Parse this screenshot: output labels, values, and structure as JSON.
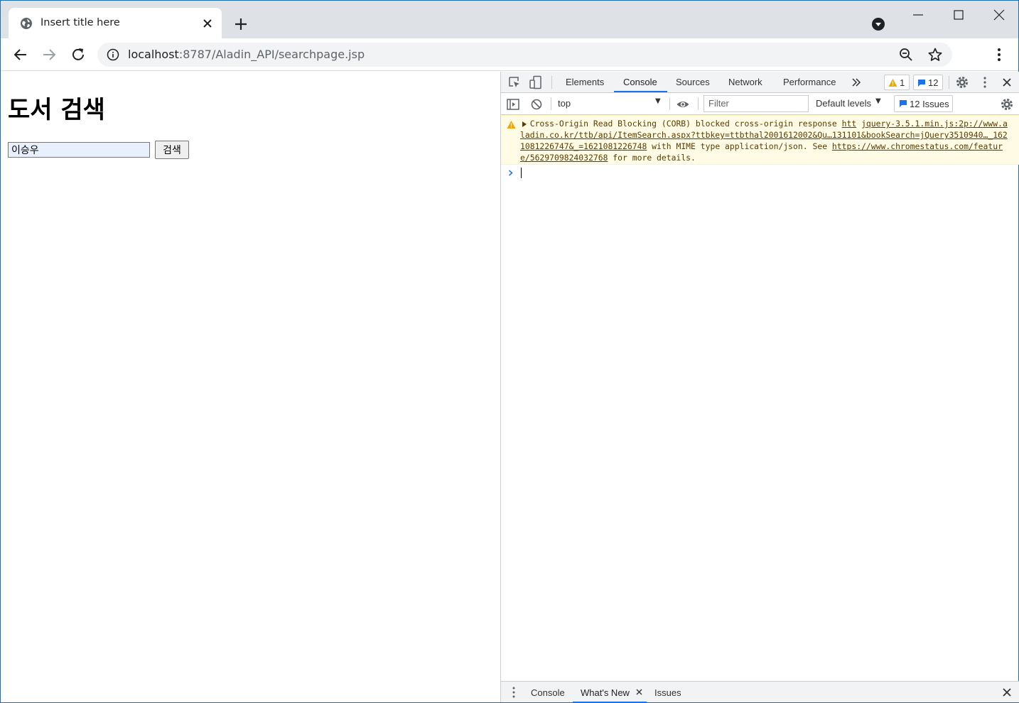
{
  "browser": {
    "tab_title": "Insert title here",
    "url_host": "localhost",
    "url_path": ":8787/Aladin_API/searchpage.jsp"
  },
  "page": {
    "heading": "도서 검색",
    "search_value": "이승우",
    "search_button": "검색"
  },
  "devtools": {
    "tabs": [
      "Elements",
      "Console",
      "Sources",
      "Network",
      "Performance"
    ],
    "active_tab": "Console",
    "warning_count": "1",
    "message_count": "12",
    "context": "top",
    "filter_placeholder": "Filter",
    "levels": "Default levels",
    "issues_label": "12 Issues",
    "warning_message": {
      "text_1": "Cross-Origin Read Blocking (CORB) blocked cross-origin response ",
      "link_1": "htt",
      "source": "jquery-3.5.1.min.js:2",
      "link_2": "p://www.aladin.co.kr/ttb/api/ItemSearch.aspx?ttbkey=ttbthal2001612002&Qu…131101&bookSearch=jQuery3510940…_1621081226747&_=1621081226748",
      "text_2": " with MIME type application/json. See ",
      "link_3": "https://www.chromestatus.com/feature/5629709824032768",
      "text_3": " for more details."
    },
    "drawer_tabs": [
      "Console",
      "What's New",
      "Issues"
    ],
    "drawer_active": "What's New"
  },
  "colors": {
    "accent": "#1a73e8",
    "warning_bg": "#fffbe5",
    "warning_text": "#5c3c00",
    "warning_icon": "#f2a600"
  }
}
